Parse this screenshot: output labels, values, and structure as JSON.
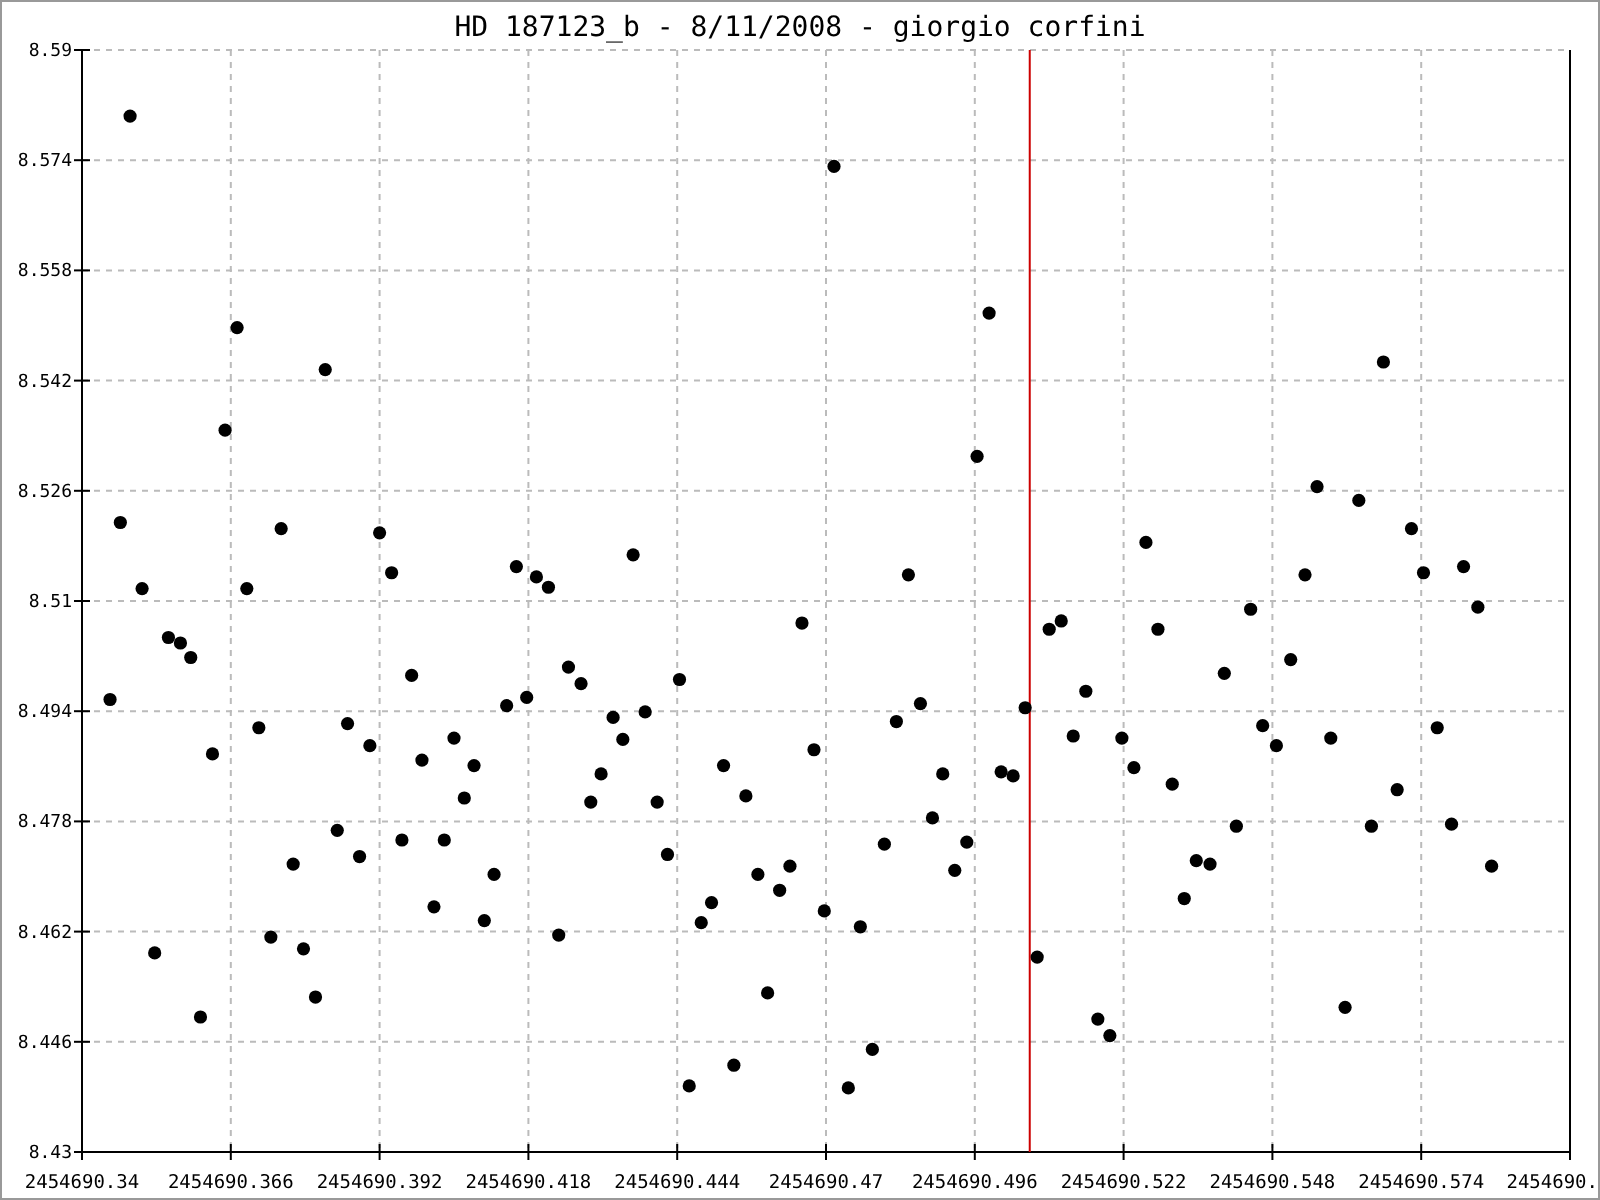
{
  "chart_data": {
    "type": "scatter",
    "title": "HD 187123_b - 8/11/2008 - giorgio corfini",
    "xlim": [
      2454690.34,
      2454690.6
    ],
    "ylim": [
      8.43,
      8.59
    ],
    "xticks": [
      2454690.34,
      2454690.366,
      2454690.392,
      2454690.418,
      2454690.444,
      2454690.47,
      2454690.496,
      2454690.522,
      2454690.548,
      2454690.574
    ],
    "yticks": [
      8.43,
      8.446,
      8.462,
      8.478,
      8.494,
      8.51,
      8.526,
      8.542,
      8.558,
      8.574,
      8.59
    ],
    "series": [
      {
        "color": "#000000",
        "x": [
          2454690.3449,
          2454690.3467,
          2454690.3484,
          2454690.3505,
          2454690.3527,
          2454690.3551,
          2454690.3572,
          2454690.359,
          2454690.3607,
          2454690.3628,
          2454690.365,
          2454690.3671,
          2454690.3688,
          2454690.3709,
          2454690.373,
          2454690.3748,
          2454690.3769,
          2454690.3787,
          2454690.3808,
          2454690.3825,
          2454690.3846,
          2454690.3864,
          2454690.3885,
          2454690.3903,
          2454690.392,
          2454690.3941,
          2454690.3959,
          2454690.3976,
          2454690.3994,
          2454690.4015,
          2454690.4033,
          2454690.405,
          2454690.4068,
          2454690.4085,
          2454690.4103,
          2454690.412,
          2454690.4142,
          2454690.4159,
          2454690.4177,
          2454690.4194,
          2454690.4215,
          2454690.4233,
          2454690.425,
          2454690.4272,
          2454690.4289,
          2454690.4307,
          2454690.4328,
          2454690.4345,
          2454690.4363,
          2454690.4384,
          2454690.4405,
          2454690.4423,
          2454690.4444,
          2454690.4461,
          2454690.4482,
          2454690.45,
          2454690.4521,
          2454690.4539,
          2454690.456,
          2454690.4581,
          2454690.4598,
          2454690.4619,
          2454690.4637,
          2454690.4658,
          2454690.4679,
          2454690.4697,
          2454690.4714,
          2454690.4739,
          2454690.476,
          2454690.4781,
          2454690.4802,
          2454690.4823,
          2454690.4844,
          2454690.4865,
          2454690.4886,
          2454690.4904,
          2454690.4925,
          2454690.4946,
          2454690.4964,
          2454690.4985,
          2454690.5006,
          2454690.5027,
          2454690.5048,
          2454690.5069,
          2454690.509,
          2454690.5111,
          2454690.5132,
          2454690.5154,
          2454690.5175,
          2454690.5196,
          2454690.5217,
          2454690.5238,
          2454690.5259,
          2454690.528,
          2454690.5305,
          2454690.5326,
          2454690.5347,
          2454690.5371,
          2454690.5396,
          2454690.5417,
          2454690.5442,
          2454690.5463,
          2454690.5487,
          2454690.5512,
          2454690.5537,
          2454690.5558,
          2454690.5582,
          2454690.5607,
          2454690.5631,
          2454690.5653,
          2454690.5674,
          2454690.5698,
          2454690.5723,
          2454690.5744,
          2454690.5768,
          2454690.5793,
          2454690.5814,
          2454690.5839,
          2454690.5863
        ],
        "values": [
          8.4957,
          8.5214,
          8.5804,
          8.5118,
          8.4589,
          8.5047,
          8.5039,
          8.5018,
          8.4496,
          8.4878,
          8.5348,
          8.5497,
          8.5118,
          8.4916,
          8.4612,
          8.5205,
          8.4718,
          8.4595,
          8.4525,
          8.5436,
          8.4767,
          8.4922,
          8.4729,
          8.489,
          8.5199,
          8.5141,
          8.4753,
          8.4992,
          8.4869,
          8.4656,
          8.4753,
          8.4901,
          8.4814,
          8.4861,
          8.4636,
          8.4703,
          8.4948,
          8.515,
          8.496,
          8.5135,
          8.512,
          8.4615,
          8.5004,
          8.498,
          8.4808,
          8.4849,
          8.4931,
          8.4899,
          8.5167,
          8.4939,
          8.4808,
          8.4732,
          8.4986,
          8.4396,
          8.4633,
          8.4662,
          8.4861,
          8.4426,
          8.4817,
          8.4703,
          8.4531,
          8.468,
          8.4715,
          8.5068,
          8.4884,
          8.465,
          8.5731,
          8.4393,
          8.4627,
          8.4449,
          8.4747,
          8.4925,
          8.5138,
          8.4951,
          8.4785,
          8.4849,
          8.4709,
          8.475,
          8.531,
          8.5518,
          8.4852,
          8.4846,
          8.4945,
          8.4583,
          8.5059,
          8.5071,
          8.4904,
          8.4969,
          8.4493,
          8.4469,
          8.4901,
          8.4858,
          8.5185,
          8.5059,
          8.4834,
          8.4668,
          8.4723,
          8.4718,
          8.4995,
          8.4773,
          8.5088,
          8.4919,
          8.489,
          8.5015,
          8.5138,
          8.5266,
          8.4901,
          8.451,
          8.5246,
          8.4773,
          8.5447,
          8.4826,
          8.5205,
          8.5141,
          8.4916,
          8.4776,
          8.515,
          8.5091,
          8.4715
        ]
      }
    ],
    "grid": true,
    "ref_lines": [
      {
        "axis": "x",
        "value": 2454690.5056,
        "color": "#cc0000"
      }
    ]
  },
  "cut_tick_label": "2454690."
}
